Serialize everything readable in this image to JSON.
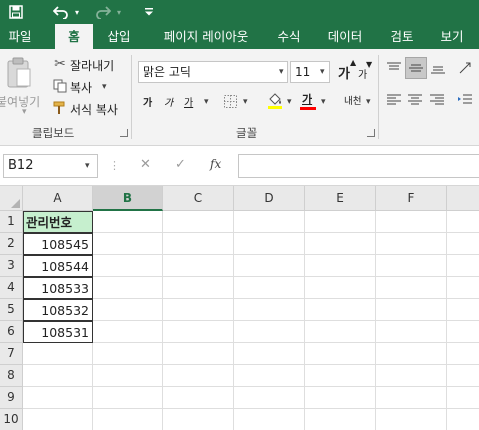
{
  "quick_access": {
    "save_icon": "save-icon",
    "undo_icon": "undo-icon",
    "redo_icon": "redo-icon",
    "customize_icon": "customize-qat-icon"
  },
  "tabs": [
    "파일",
    "홈",
    "삽입",
    "페이지 레이아웃",
    "수식",
    "데이터",
    "검토",
    "보기"
  ],
  "active_tab": "홈",
  "clipboard": {
    "paste_label": "붙여넣기",
    "cut_label": "잘라내기",
    "copy_label": "복사",
    "format_painter_label": "서식 복사",
    "group_label": "클립보드"
  },
  "font": {
    "name": "맑은 고딕",
    "size": "11",
    "grow_label": "가",
    "shrink_label": "가",
    "bold_label": "가",
    "italic_label": "가",
    "underline_label": "가",
    "color_label": "가",
    "phonetic_label": "내천",
    "group_label": "글꼴",
    "font_color": "#ff0000",
    "fill_color": "#ffff00"
  },
  "formula_bar": {
    "name_box": "B12",
    "cancel_symbol": "✕",
    "enter_symbol": "✓",
    "fx_label": "fx",
    "formula": ""
  },
  "sheet": {
    "columns": [
      "A",
      "B",
      "C",
      "D",
      "E",
      "F"
    ],
    "selected_column": "B",
    "rows": [
      "1",
      "2",
      "3",
      "4",
      "5",
      "6",
      "7",
      "8",
      "9",
      "10"
    ],
    "header_fill": "#c6efce",
    "cells_a": [
      "관리번호",
      "108545",
      "108544",
      "108533",
      "108532",
      "108531",
      "",
      "",
      "",
      ""
    ]
  }
}
